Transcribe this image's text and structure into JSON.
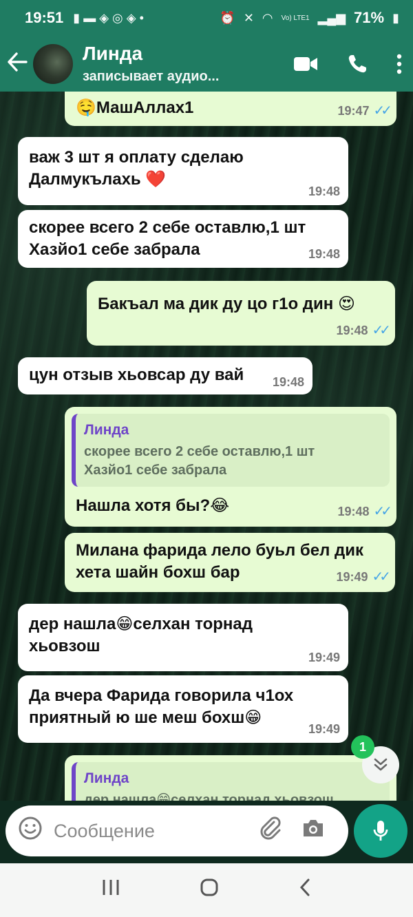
{
  "status_bar": {
    "time": "19:51",
    "battery": "71%",
    "network": "Vo) LTE1"
  },
  "header": {
    "contact_name": "Линда",
    "contact_status": "записывает аудио..."
  },
  "messages": [
    {
      "dir": "out",
      "text": "МашАллах1",
      "emoji_prefix": "🤤",
      "time": "19:47",
      "read": true
    },
    {
      "dir": "in",
      "text": "важ 3 шт я оплату сделаю\nДалмукълахь ❤️",
      "time": "19:48"
    },
    {
      "dir": "in",
      "text": "скорее всего 2 себе оставлю,1 шт\nХазйо1 себе забрала",
      "time": "19:48"
    },
    {
      "dir": "out",
      "text": "Бакъал ма дик ду цо г1о дин 😍",
      "time": "19:48",
      "read": true
    },
    {
      "dir": "in",
      "text": "цун отзыв хьовсар ду вай",
      "time": "19:48"
    },
    {
      "dir": "out",
      "quote_name": "Линда",
      "quote_text": "скорее всего 2 себе оставлю,1 шт\nХазйо1 себе забрала",
      "text": "Нашла хотя бы?😂",
      "time": "19:48",
      "read": true
    },
    {
      "dir": "out",
      "text": "Милана фарида лело буьл бел дик\nхета шайн бохш бар",
      "time": "19:49",
      "read": true
    },
    {
      "dir": "in",
      "text": "дер нашла😁селхан торнад\nхьовзош",
      "time": "19:49"
    },
    {
      "dir": "in",
      "text": "Да вчера Фарида говорила ч1ох\nприятный ю ше меш бохш😁",
      "time": "19:49"
    },
    {
      "dir": "out",
      "quote_name": "Линда",
      "quote_text": "дер нашла😁селхан торнад хьовзош",
      "text": "",
      "time": ""
    }
  ],
  "unread_count": "1",
  "input": {
    "placeholder": "Сообщение"
  },
  "colors": {
    "header": "#1f7c62",
    "outgoing_bubble": "#e7fbd3",
    "incoming_bubble": "#ffffff",
    "read_check": "#48a6e6",
    "mic_button": "#13a387",
    "quote_name": "#6e44c8"
  },
  "icons": {
    "back": "back-arrow-icon",
    "video": "video-call-icon",
    "call": "phone-icon",
    "menu": "more-vert-icon",
    "emoji": "emoji-icon",
    "attach": "paperclip-icon",
    "camera": "camera-icon",
    "mic": "mic-icon",
    "scroll": "chevron-double-down-icon"
  }
}
